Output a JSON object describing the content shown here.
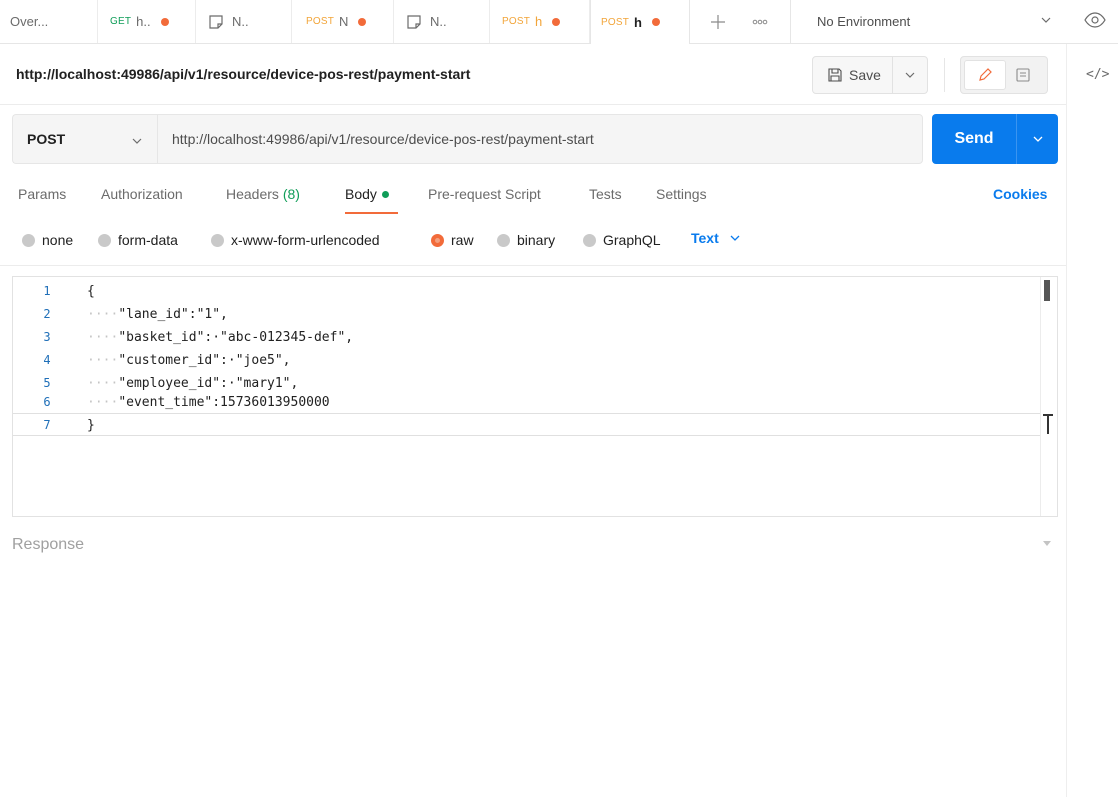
{
  "tabs": [
    {
      "method": "",
      "title": "Over...",
      "has_dot": false
    },
    {
      "method": "GET",
      "title": "h..",
      "has_dot": true
    },
    {
      "method": "",
      "title": "N..",
      "has_dot": false,
      "icon": "note-icon"
    },
    {
      "method": "POST",
      "title": "N",
      "has_dot": true
    },
    {
      "method": "",
      "title": "N..",
      "has_dot": false,
      "icon": "note-icon"
    },
    {
      "method": "POST",
      "title": "h",
      "has_dot": true
    },
    {
      "method": "POST",
      "title": "h",
      "has_dot": true,
      "active": true
    }
  ],
  "tab_actions": {
    "new_tab_icon": "plus-icon",
    "more_icon": "ellipsis-icon"
  },
  "environment": {
    "selected": "No Environment",
    "view_icon": "eye-icon"
  },
  "request": {
    "title": "http://localhost:49986/api/v1/resource/device-pos-rest/payment-start",
    "method": "POST",
    "url": "http://localhost:49986/api/v1/resource/device-pos-rest/payment-start",
    "save_label": "Save",
    "send_label": "Send"
  },
  "request_tabs": [
    {
      "label": "Params"
    },
    {
      "label": "Authorization"
    },
    {
      "label": "Headers",
      "count": "(8)"
    },
    {
      "label": "Body",
      "active": true
    },
    {
      "label": "Pre-request Script"
    },
    {
      "label": "Tests"
    },
    {
      "label": "Settings"
    }
  ],
  "cookies_label": "Cookies",
  "body_types": [
    {
      "label": "none",
      "selected": false
    },
    {
      "label": "form-data",
      "selected": false
    },
    {
      "label": "x-www-form-urlencoded",
      "selected": false
    },
    {
      "label": "raw",
      "selected": true
    },
    {
      "label": "binary",
      "selected": false
    },
    {
      "label": "GraphQL",
      "selected": false
    }
  ],
  "raw_format": "Text",
  "editor": {
    "lines": [
      {
        "n": "1",
        "ws": "",
        "text": "{"
      },
      {
        "n": "2",
        "ws": "····",
        "text": "\"lane_id\":\"1\","
      },
      {
        "n": "3",
        "ws": "····",
        "text": "\"basket_id\":·\"abc-012345-def\","
      },
      {
        "n": "4",
        "ws": "····",
        "text": "\"customer_id\":·\"joe5\","
      },
      {
        "n": "5",
        "ws": "····",
        "text": "\"employee_id\":·\"mary1\","
      },
      {
        "n": "6",
        "ws": "····",
        "text": "\"event_time\":15736013950000"
      },
      {
        "n": "7",
        "ws": "",
        "text": "}"
      }
    ]
  },
  "response_label": "Response",
  "colors": {
    "accent": "#097bed",
    "active_tab": "#f26b3a",
    "get": "#0f9d58",
    "post": "#f2a53a"
  }
}
